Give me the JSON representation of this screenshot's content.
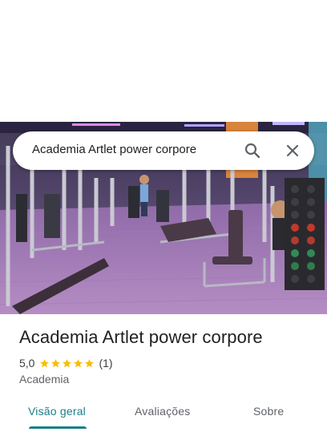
{
  "search": {
    "query": "Academia Artlet power corpore"
  },
  "place": {
    "title": "Academia Artlet power corpore",
    "rating": "5,0",
    "stars_filled": 5,
    "stars_total": 5,
    "review_count": "(1)",
    "category": "Academia"
  },
  "tabs": [
    {
      "label": "Visão geral",
      "active": true
    },
    {
      "label": "Avaliações",
      "active": false
    },
    {
      "label": "Sobre",
      "active": false
    }
  ],
  "colors": {
    "accent": "#1a7f86",
    "star": "#fbbc04"
  },
  "icons": {
    "search": "search-icon",
    "close": "close-icon",
    "star": "star-icon"
  }
}
